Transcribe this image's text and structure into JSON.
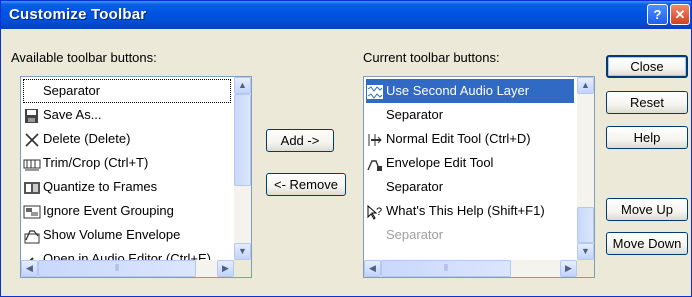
{
  "window": {
    "title": "Customize Toolbar",
    "help_icon": "?",
    "close_icon": "✕"
  },
  "available": {
    "label": "Available toolbar buttons:",
    "items": [
      {
        "label": "Separator",
        "icon": "none"
      },
      {
        "label": "Save As...",
        "icon": "floppy-icon"
      },
      {
        "label": "Delete (Delete)",
        "icon": "delete-x-icon"
      },
      {
        "label": "Trim/Crop (Ctrl+T)",
        "icon": "trim-icon"
      },
      {
        "label": "Quantize to Frames",
        "icon": "quantize-icon"
      },
      {
        "label": "Ignore Event Grouping",
        "icon": "grouping-icon"
      },
      {
        "label": "Show Volume Envelope",
        "icon": "volume-envelope-icon"
      },
      {
        "label": "Open in Audio Editor (Ctrl+E)",
        "icon": "audio-editor-icon"
      }
    ]
  },
  "current": {
    "label": "Current toolbar buttons:",
    "items": [
      {
        "label": "Use Second Audio Layer",
        "icon": "audio-layer-icon",
        "selected": true
      },
      {
        "label": "Separator",
        "icon": "none"
      },
      {
        "label": "Normal Edit Tool (Ctrl+D)",
        "icon": "edit-tool-icon"
      },
      {
        "label": "Envelope Edit Tool",
        "icon": "envelope-tool-icon"
      },
      {
        "label": "Separator",
        "icon": "none"
      },
      {
        "label": "What's This Help (Shift+F1)",
        "icon": "whats-this-icon"
      },
      {
        "label": "Separator",
        "icon": "none",
        "disabled": true
      }
    ]
  },
  "buttons": {
    "add": "Add ->",
    "remove": "<- Remove",
    "close": "Close",
    "reset": "Reset",
    "help": "Help",
    "move_up": "Move Up",
    "move_down": "Move Down"
  },
  "scroll_glyphs": {
    "up": "▲",
    "down": "▼",
    "left": "◀",
    "right": "▶",
    "grip": "⦀"
  }
}
